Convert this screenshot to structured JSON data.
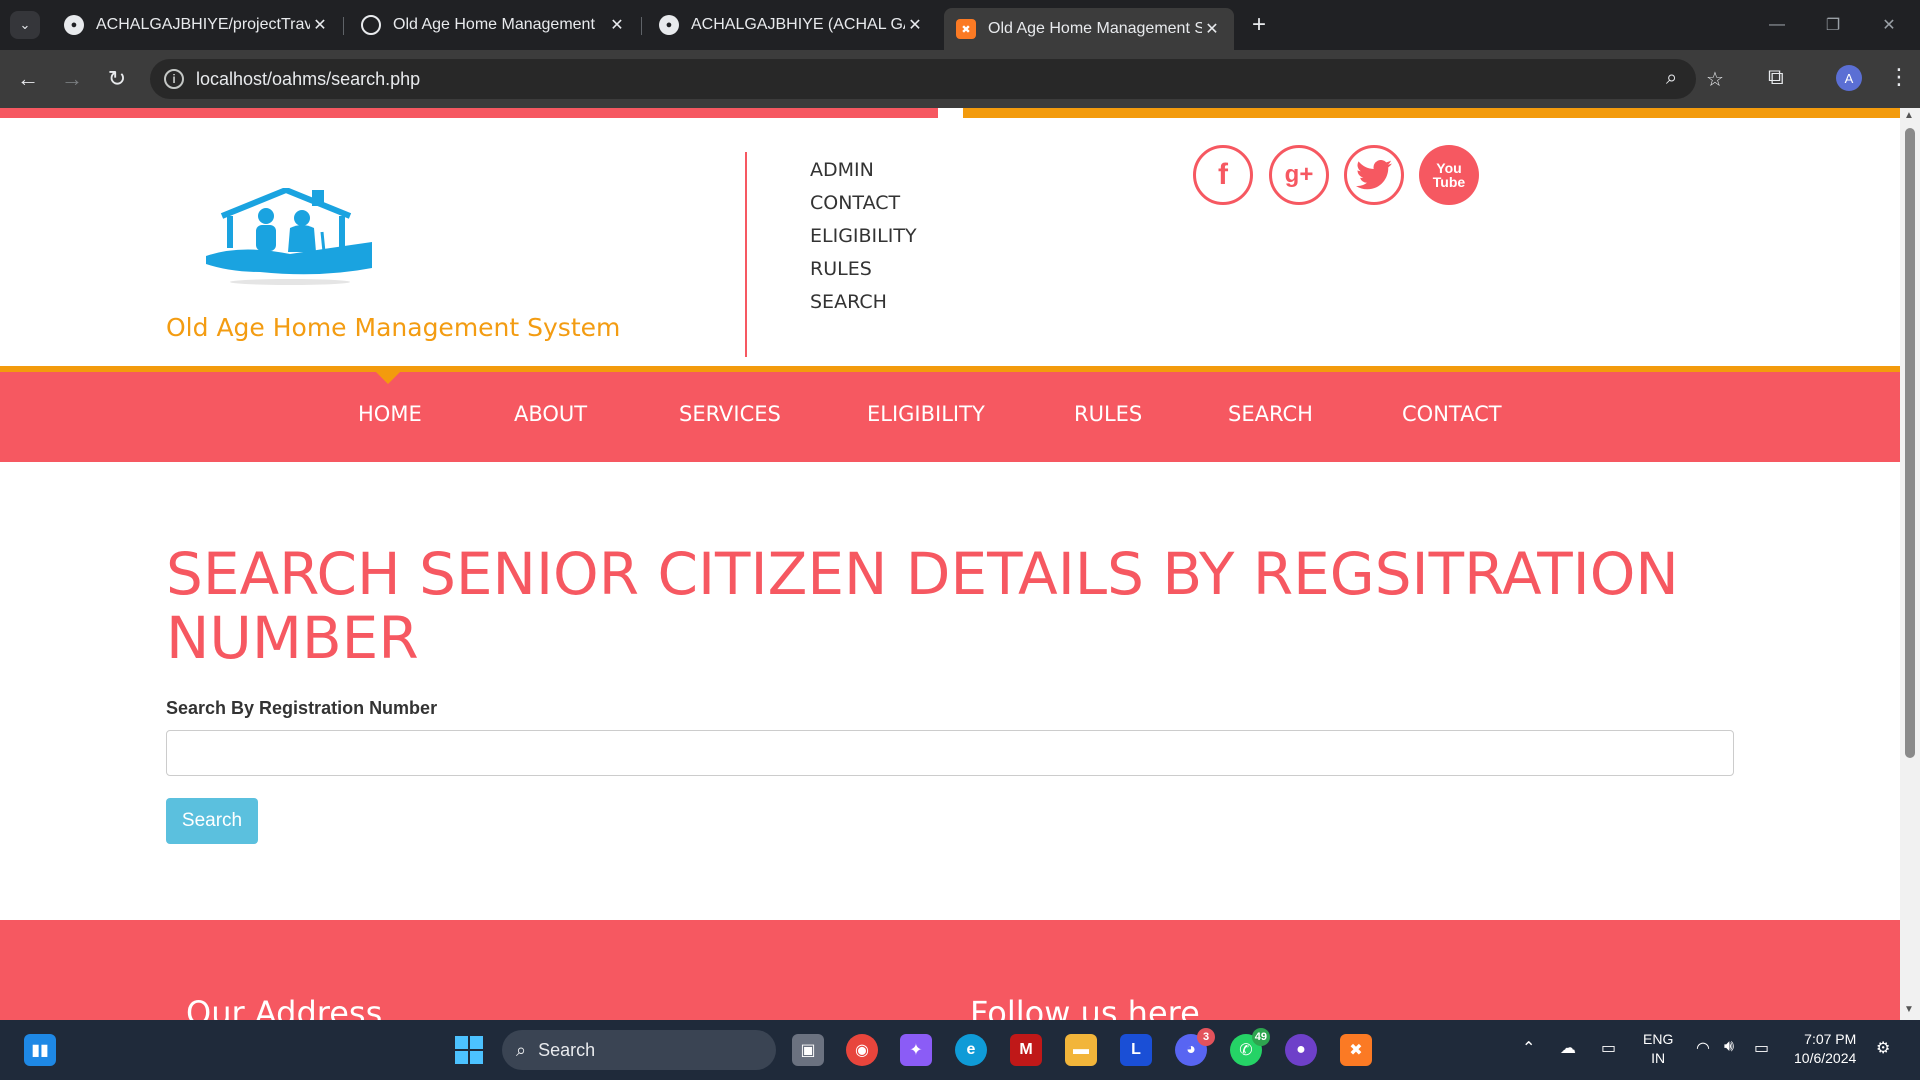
{
  "browser": {
    "tabs": [
      {
        "title": "ACHALGAJBHIYE/projectTravell",
        "favicon": "github-icon"
      },
      {
        "title": "Old Age Home Management",
        "favicon": "chatgpt-icon"
      },
      {
        "title": "ACHALGAJBHIYE (ACHAL GAJBH",
        "favicon": "github-icon"
      },
      {
        "title": "Old Age Home Management Sy",
        "favicon": "xampp-icon",
        "active": true
      }
    ],
    "url": "localhost/oahms/search.php",
    "profile_initial": "A"
  },
  "site": {
    "name": "Old Age Home Management System",
    "top_links": [
      "ADMIN",
      "CONTACT",
      "ELIGIBILITY",
      "RULES",
      "SEARCH"
    ],
    "social": [
      "f",
      "g+",
      "twitter-icon",
      "You Tube"
    ],
    "menu": [
      "HOME",
      "ABOUT",
      "SERVICES",
      "ELIGIBILITY",
      "RULES",
      "SEARCH",
      "CONTACT"
    ],
    "active_menu": "HOME",
    "accent_color": "#f65861",
    "secondary_color": "#f39b0d"
  },
  "main": {
    "title": "SEARCH SENIOR CITIZEN DETAILS BY REGSITRATION NUMBER",
    "search_label": "Search By Registration Number",
    "search_value": "",
    "search_button": "Search"
  },
  "footer": {
    "address_heading": "Our Address",
    "follow_heading": "Follow us here"
  },
  "taskbar": {
    "search_label": "Search",
    "discord_badge": "3",
    "whatsapp_badge": "49",
    "lang_top": "ENG",
    "lang_bottom": "IN",
    "time": "7:07 PM",
    "date": "10/6/2024"
  }
}
